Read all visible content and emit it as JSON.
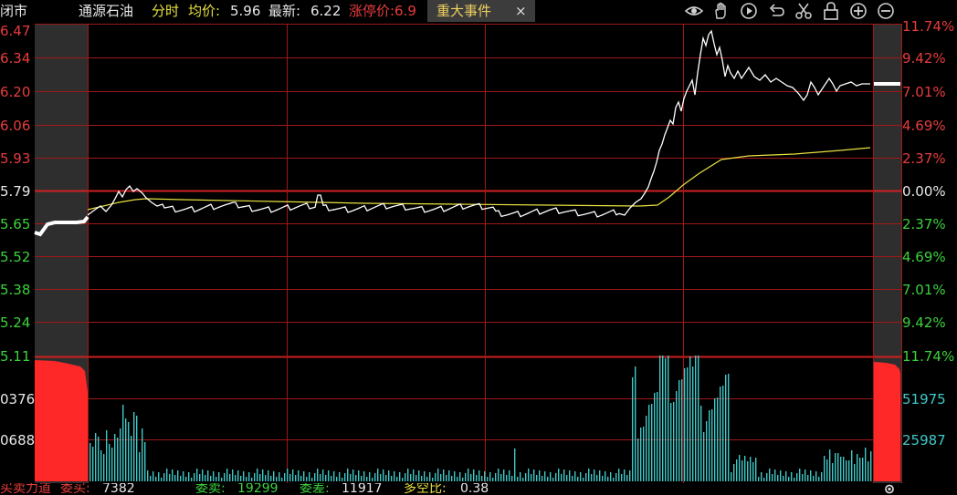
{
  "header": {
    "status": "闭市",
    "stock_name": "通源石油",
    "mode": "分时",
    "avg_label": "均价:",
    "avg_value": "5.96",
    "last_label": "最新:",
    "last_value": "6.22",
    "limit_label": "涨停价:6.9",
    "event_tab": "重大事件",
    "event_close": "×"
  },
  "toolbar_icons": [
    "eye-icon",
    "hand-icon",
    "play-icon",
    "undo-icon",
    "scissors-icon",
    "lock-icon",
    "zoom-in-icon",
    "zoom-out-icon"
  ],
  "left_prices": [
    {
      "text": "6.47",
      "color": "#e83c3c"
    },
    {
      "text": "6.34",
      "color": "#e83c3c"
    },
    {
      "text": "6.20",
      "color": "#e83c3c"
    },
    {
      "text": "6.06",
      "color": "#e83c3c"
    },
    {
      "text": "5.93",
      "color": "#e83c3c"
    },
    {
      "text": "5.79",
      "color": "#e8e8e8"
    },
    {
      "text": "5.65",
      "color": "#3cd23c"
    },
    {
      "text": "5.52",
      "color": "#3cd23c"
    },
    {
      "text": "5.38",
      "color": "#3cd23c"
    },
    {
      "text": "5.24",
      "color": "#3cd23c"
    },
    {
      "text": "5.11",
      "color": "#3cd23c"
    }
  ],
  "right_percents": [
    {
      "text": "11.74%",
      "color": "#e83c3c"
    },
    {
      "text": "9.42%",
      "color": "#e83c3c"
    },
    {
      "text": "7.01%",
      "color": "#e83c3c"
    },
    {
      "text": "4.69%",
      "color": "#e83c3c"
    },
    {
      "text": "2.37%",
      "color": "#e83c3c"
    },
    {
      "text": "0.00%",
      "color": "#e8e8e8"
    },
    {
      "text": "2.37%",
      "color": "#3cd23c"
    },
    {
      "text": "4.69%",
      "color": "#3cd23c"
    },
    {
      "text": "7.01%",
      "color": "#3cd23c"
    },
    {
      "text": "9.42%",
      "color": "#3cd23c"
    },
    {
      "text": "11.74%",
      "color": "#3cd23c"
    }
  ],
  "volume_left_labels": [
    "0376",
    "0688"
  ],
  "volume_right_labels": [
    "51975",
    "25987"
  ],
  "footer": {
    "title": "买卖力道",
    "buy_label": "委买:",
    "buy_value": "7382",
    "sell_label": "委卖:",
    "sell_value": "19299",
    "diff_label": "委差:",
    "diff_value": "11917",
    "ratio_label": "多空比:",
    "ratio_value": "0.38"
  },
  "colors": {
    "grid": "#a01818",
    "price_line": "#ffffff",
    "avg_line": "#e8e040",
    "volume_white": "#e8e8e8",
    "volume_yellow": "#e0d060",
    "volume_cyan": "#40c8c8",
    "auction_bg": "#2e2e2e",
    "auction_fill": "#ff2828"
  }
}
